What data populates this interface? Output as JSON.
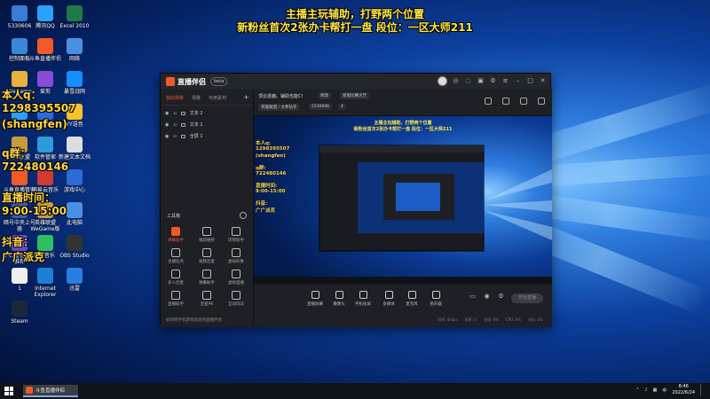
{
  "banner": {
    "line1": "主播主玩辅助，打野两个位置",
    "line2": "新粉丝首次2张办卡帮打一盘    段位：一区大师211"
  },
  "overlay": {
    "qq_label": "本人q：",
    "qq_number": "1298395507",
    "qq_name": "(shangfen)",
    "group_label": "q群：",
    "group_number": "722480146",
    "time_label": "直播时间：",
    "time_value": "9:00-15:00",
    "douyin_label": "抖音：",
    "douyin_value": "广广派克"
  },
  "desktop_icons": [
    {
      "label": "5330606",
      "color": "#3a7bd5"
    },
    {
      "label": "腾讯QQ",
      "color": "#2aa0ff"
    },
    {
      "label": "Excel 2010",
      "color": "#1e7b45"
    },
    {
      "label": "控制面板",
      "color": "#3a86d8"
    },
    {
      "label": "斗鱼直播伴侣",
      "color": "#f05a28"
    },
    {
      "label": "网络",
      "color": "#4a90e2"
    },
    {
      "label": "WeGame",
      "color": "#e9b23a"
    },
    {
      "label": "爱剪",
      "color": "#8a4bd6"
    },
    {
      "label": "暴雪战网",
      "color": "#148eff"
    },
    {
      "label": "腾讯QQ",
      "color": "#2aa0ff"
    },
    {
      "label": "网易UU加速器",
      "color": "#2c6bd6"
    },
    {
      "label": "YY语音",
      "color": "#f7c42c"
    },
    {
      "label": "英雄联盟",
      "color": "#c89b3c"
    },
    {
      "label": "软件管家",
      "color": "#2d9cdb"
    },
    {
      "label": "新建文本文档",
      "color": "#dddddd"
    },
    {
      "label": "斗鱼直播管家",
      "color": "#f05a28"
    },
    {
      "label": "网易云音乐",
      "color": "#d33a31"
    },
    {
      "label": "游戏中心",
      "color": "#2c6bd6"
    },
    {
      "label": "暗号中央上号器",
      "color": "#3a5ea8"
    },
    {
      "label": "英雄联盟WeGame版",
      "color": "#c89b3c"
    },
    {
      "label": "此电脑",
      "color": "#4a90e2"
    },
    {
      "label": "护石查看官方推荐",
      "color": "#6b4bd6"
    },
    {
      "label": "QQ音乐",
      "color": "#2fbf62"
    },
    {
      "label": "OBS Studio",
      "color": "#333333"
    },
    {
      "label": "1",
      "color": "#eeeeee"
    },
    {
      "label": "Internet Explorer",
      "color": "#1f7fd6"
    },
    {
      "label": "迅雷",
      "color": "#2a7de1"
    },
    {
      "label": "Steam",
      "color": "#1b2838"
    }
  ],
  "app": {
    "title": "直播伴侣",
    "version": "beta",
    "left_tabs": [
      "我的场景",
      "场景",
      "可用素材"
    ],
    "sources": [
      "文本 2",
      "文本 1",
      "全屏 1"
    ],
    "tools_title": "工具箱",
    "tools": [
      {
        "label": "弹幕助手",
        "hot": true
      },
      {
        "label": "福袋抽奖",
        "hot": false
      },
      {
        "label": "房管助手",
        "hot": false
      },
      {
        "label": "主播任务",
        "hot": false
      },
      {
        "label": "视频连麦",
        "hot": false
      },
      {
        "label": "虚拟形象",
        "hot": false
      },
      {
        "label": "多人连麦",
        "hot": false
      },
      {
        "label": "弹幕助手",
        "hot": false
      },
      {
        "label": "虚拟直播",
        "hot": false
      },
      {
        "label": "直播助手",
        "hot": false
      },
      {
        "label": "连麦PK",
        "hot": false
      },
      {
        "label": "互动玩法",
        "hot": false
      }
    ],
    "bottom_hint": "如何把手机游戏投屏到直播伴侣",
    "room_title": "顶云逐鹿。辅助也能C!",
    "room_tag": "修改",
    "room_category": "英雄联盟 / 大师钻守",
    "room_id": "5330606",
    "room_count": "4",
    "room_label": "新版比赛大厅",
    "bottom_items": [
      "直播屏幕",
      "摄像头",
      "手机投屏",
      "多媒体",
      "麦克风",
      "扬声器"
    ],
    "live_button": "开始直播",
    "stats": [
      "码率: 0kbps",
      "帧率: 0",
      "丢帧: 0%",
      "CPU: 4%",
      "内存: 0%"
    ]
  },
  "preview": {
    "banner1": "主播主玩辅助，打野两个位置",
    "banner2": "新粉丝首次2张办卡帮打一盘    段位：一区大师211",
    "nested_overlay": [
      "本人q:",
      "1298395507",
      "(shangfen)",
      "q群:",
      "722480146",
      "直播时间:",
      "9:00-15:00",
      "抖音:",
      "广广派克"
    ]
  },
  "taskbar": {
    "app_label": "斗鱼直播伴侣",
    "time": "8:46",
    "date": "2022/6/24"
  }
}
